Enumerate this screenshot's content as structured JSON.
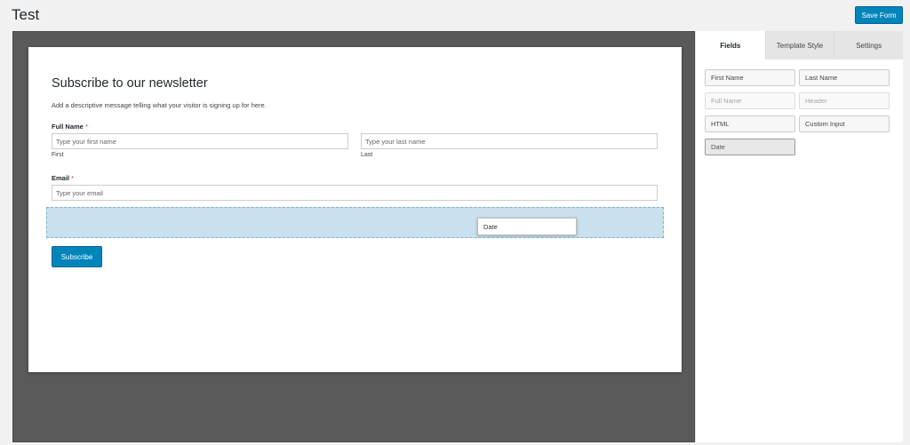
{
  "page": {
    "title": "Test",
    "save_label": "Save Form"
  },
  "form": {
    "heading": "Subscribe to our newsletter",
    "description": "Add a descriptive message telling what your visitor is signing up for here.",
    "full_name": {
      "label": "Full Name",
      "required_mark": "*",
      "first_placeholder": "Type your first name",
      "last_placeholder": "Type your last name",
      "first_sublabel": "First",
      "last_sublabel": "Last"
    },
    "email": {
      "label": "Email",
      "required_mark": "*",
      "placeholder": "Type your email"
    },
    "drag_chip_label": "Date",
    "submit_label": "Subscribe"
  },
  "sidebar": {
    "tabs": [
      {
        "label": "Fields",
        "active": true
      },
      {
        "label": "Template Style",
        "active": false
      },
      {
        "label": "Settings",
        "active": false
      }
    ],
    "fields": [
      {
        "label": "First Name",
        "state": "enabled"
      },
      {
        "label": "Last Name",
        "state": "enabled"
      },
      {
        "label": "Full Name",
        "state": "disabled"
      },
      {
        "label": "Header",
        "state": "disabled"
      },
      {
        "label": "HTML",
        "state": "enabled"
      },
      {
        "label": "Custom Input",
        "state": "enabled"
      },
      {
        "label": "Date",
        "state": "selected"
      }
    ]
  },
  "colors": {
    "accent": "#0085ba",
    "required": "#dc3232",
    "drop_zone": "#c9e0ee",
    "canvas": "#5a5a5a"
  }
}
